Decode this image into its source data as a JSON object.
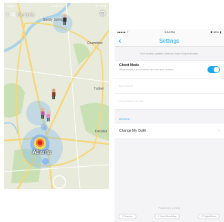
{
  "map_screen": {
    "status": {
      "left": "●●●●● ⌔",
      "time": "12:09 PM",
      "right": "✱ 73% ▮"
    },
    "search_label": "Search",
    "places": {
      "sandy_springs": "Sandy Springs",
      "chamblee": "Chamblee",
      "tucker": "Tucker",
      "decatur": "Decatur",
      "atlanta": "Atlanta"
    },
    "colors": {
      "water": "#a9d3ea",
      "park": "#c9e0b4",
      "land": "#e8eadb",
      "road": "#f5d77a"
    },
    "icons": {
      "back": "chevron-left-icon",
      "search": "search-icon",
      "settings": "gear-icon"
    }
  },
  "settings_screen": {
    "status": {
      "left": "●●●●● ⌔",
      "time": "3:24 PM",
      "right": "✱ 81% ▮"
    },
    "nav": {
      "back": "‹",
      "title": "Settings"
    },
    "description": "Your location updates while you have Snapchat open.",
    "ghost_mode": {
      "title": "Ghost Mode",
      "subtitle": "When enabled, your friends can't see your location.",
      "enabled": true
    },
    "faded_rows": [
      "My Friends",
      "Only These Friends..."
    ],
    "section_header": "BITMOJI",
    "outfit_row": {
      "label": "Change My Outfit",
      "arrow": "›"
    },
    "footer": "Powered by ◎ Zenly",
    "footer_links": [
      "© Mapbox",
      "© OpenStreetMap",
      "© DigitalGlobe"
    ],
    "accent_color": "#1aa7ec"
  }
}
